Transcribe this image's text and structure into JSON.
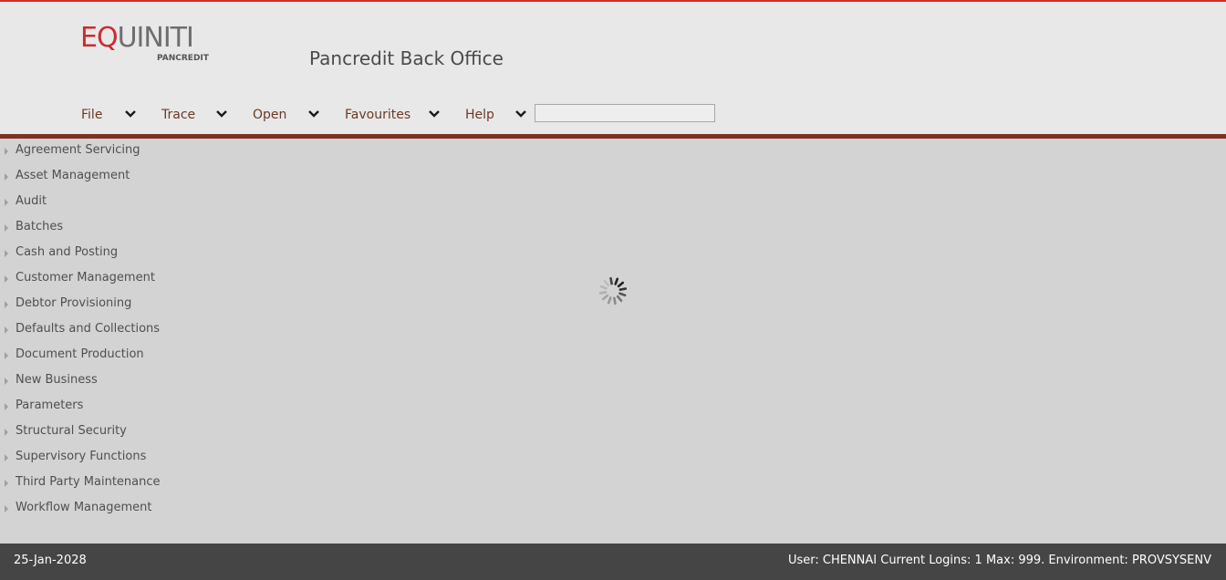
{
  "header": {
    "logo": {
      "prefix": "EQ",
      "rest": "UINITI",
      "subtitle": "PANCREDIT"
    },
    "app_title": "Pancredit Back Office",
    "accent_color": "#7a3421"
  },
  "menu": [
    {
      "label": "File"
    },
    {
      "label": "Trace"
    },
    {
      "label": "Open"
    },
    {
      "label": "Favourites"
    },
    {
      "label": "Help"
    }
  ],
  "search": {
    "value": "",
    "placeholder": ""
  },
  "sidebar": {
    "items": [
      {
        "label": "Agreement Servicing"
      },
      {
        "label": "Asset Management"
      },
      {
        "label": "Audit"
      },
      {
        "label": "Batches"
      },
      {
        "label": "Cash and Posting"
      },
      {
        "label": "Customer Management"
      },
      {
        "label": "Debtor Provisioning"
      },
      {
        "label": "Defaults and Collections"
      },
      {
        "label": "Document Production"
      },
      {
        "label": "New Business"
      },
      {
        "label": "Parameters"
      },
      {
        "label": "Structural Security"
      },
      {
        "label": "Supervisory Functions"
      },
      {
        "label": "Third Party Maintenance"
      },
      {
        "label": "Workflow Management"
      }
    ]
  },
  "footer": {
    "date": "25-Jan-2028",
    "status": "User: CHENNAI  Current Logins: 1  Max: 999.  Environment: PROVSYSENV"
  }
}
